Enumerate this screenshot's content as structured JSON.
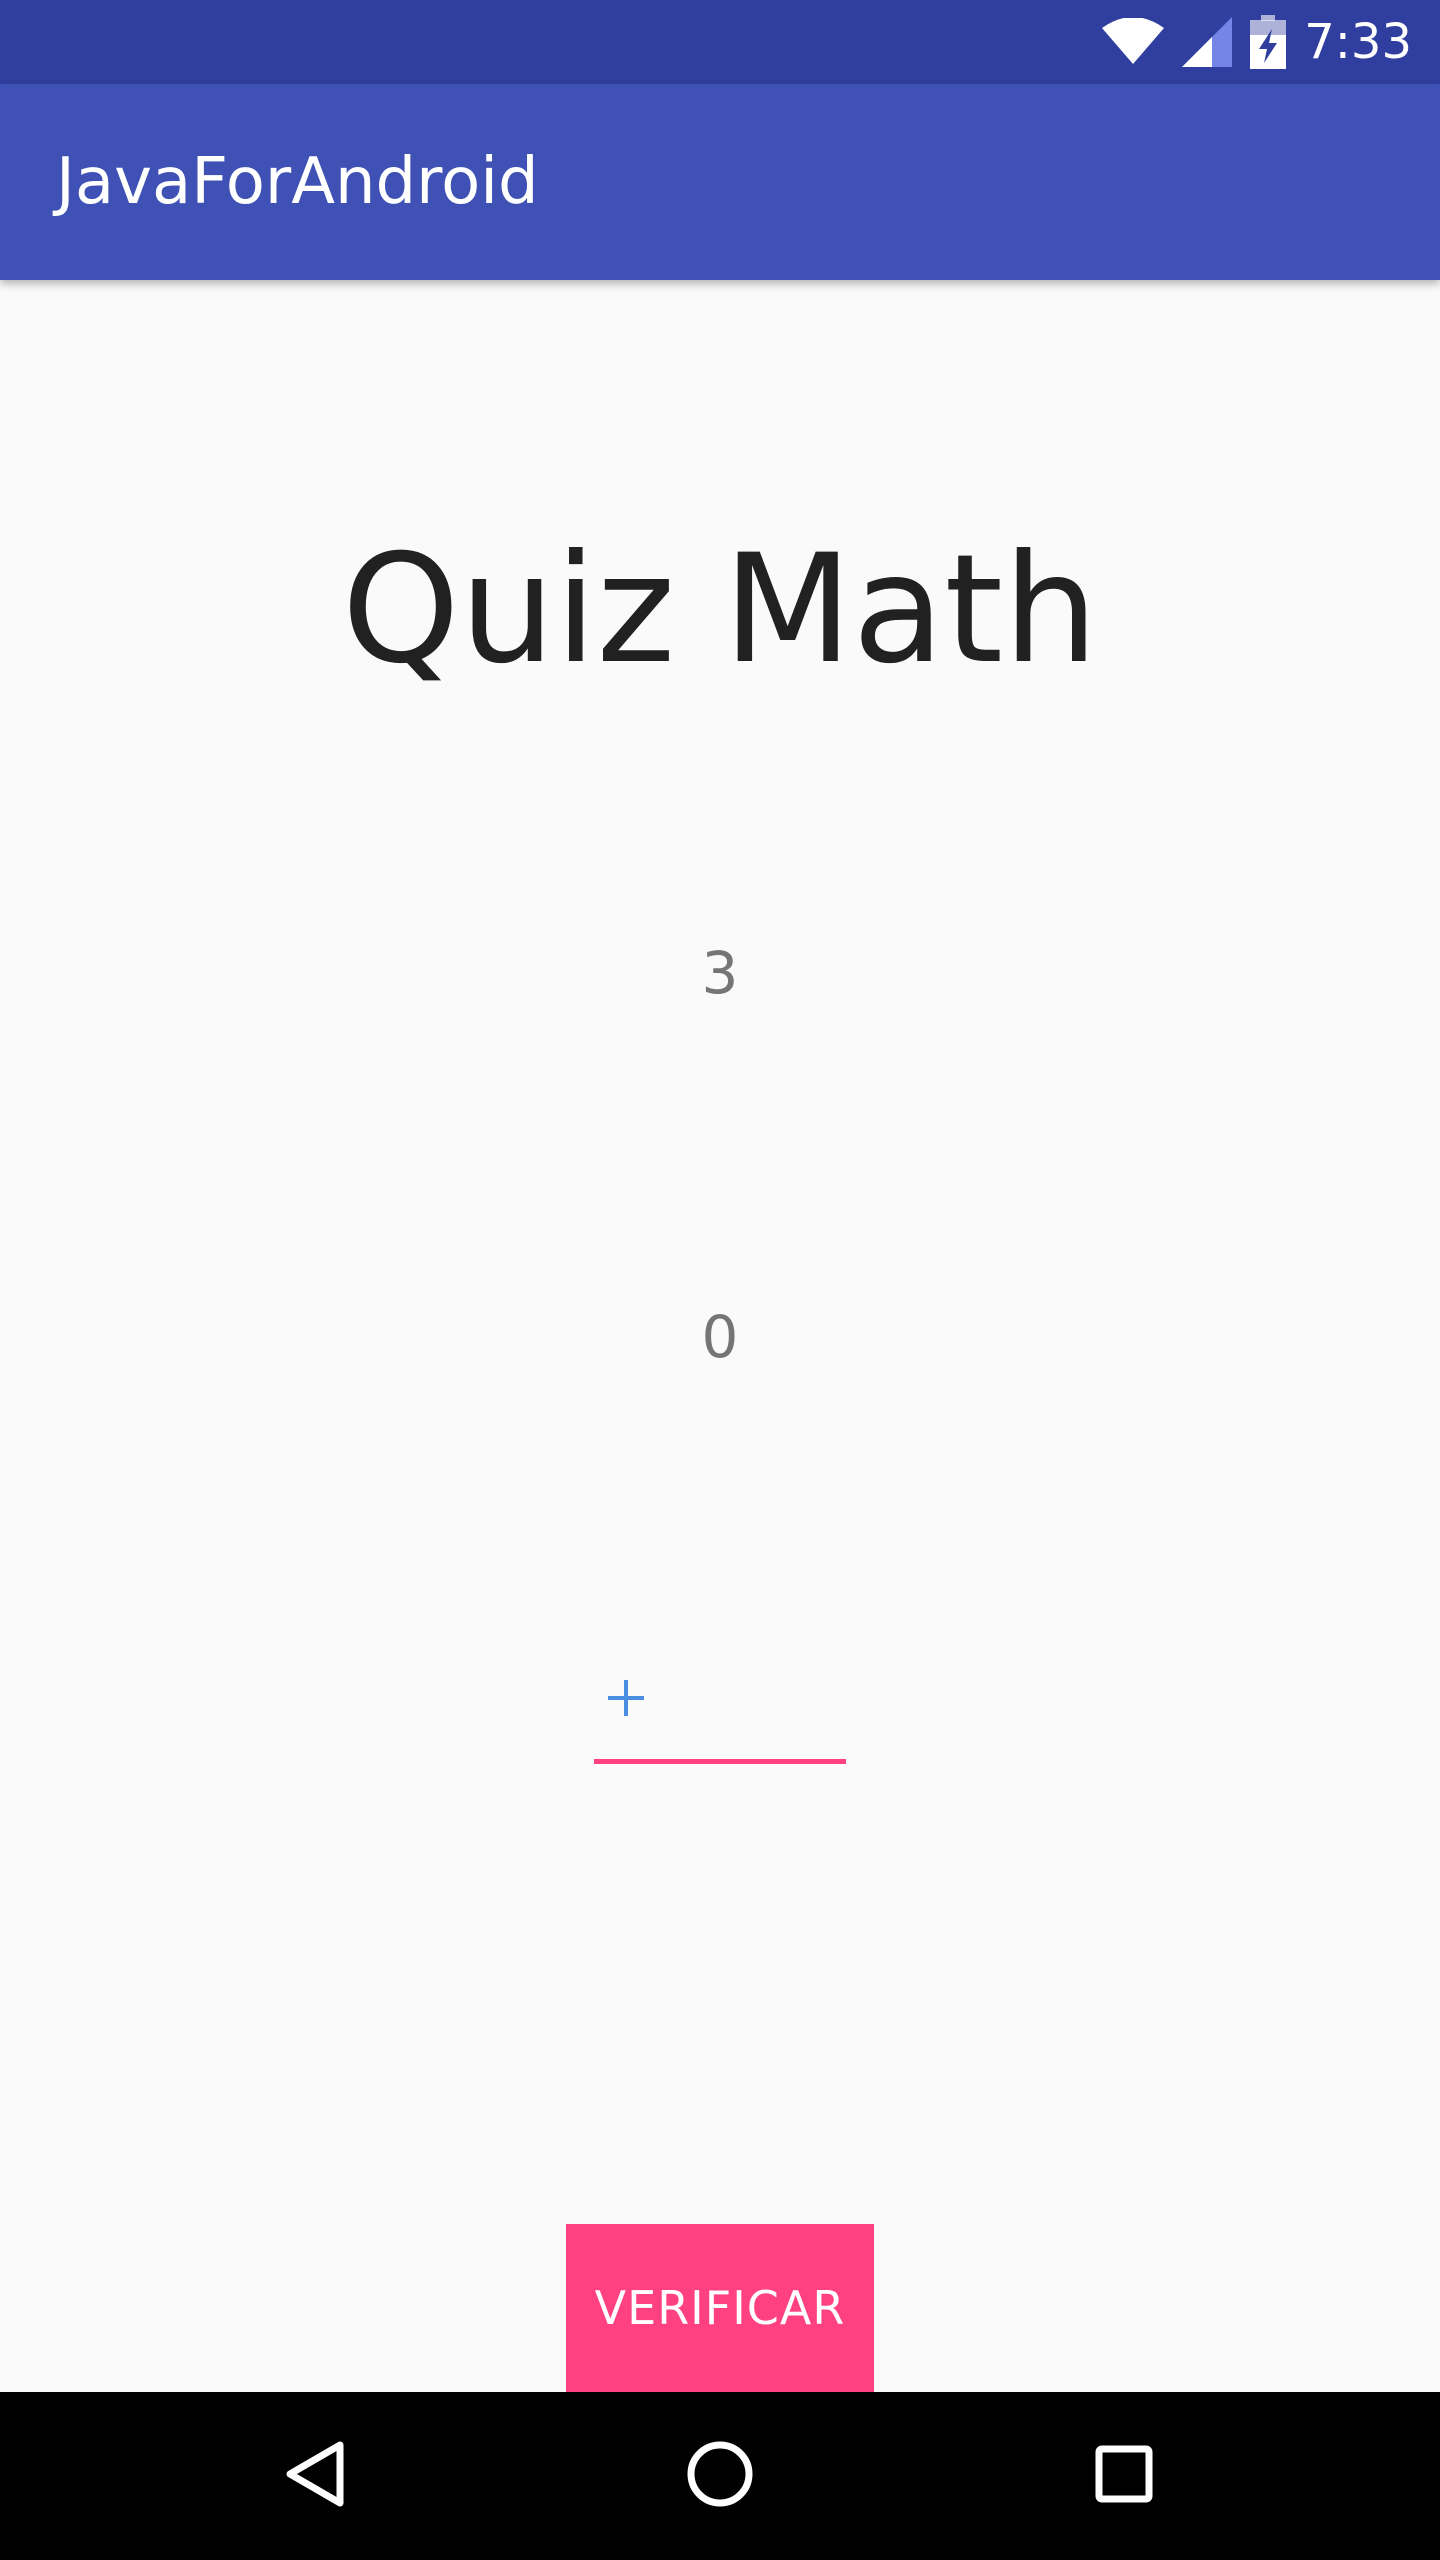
{
  "status_bar": {
    "time": "7:33",
    "icons": [
      "wifi-icon",
      "signal-icon",
      "battery-charging-icon"
    ],
    "background": "#303f9f"
  },
  "app_bar": {
    "title": "JavaForAndroid",
    "background": "#3f51b5"
  },
  "main": {
    "title": "Quiz Math",
    "first_number": "3",
    "second_number": "0",
    "answer": {
      "operator_icon": "plus-icon",
      "value": "",
      "underline_color": "#ff4081"
    },
    "verify_button_label": "VERIFICAR",
    "accent": "#ff4081"
  },
  "nav_bar": {
    "buttons": [
      "back-icon",
      "home-icon",
      "recents-icon"
    ]
  }
}
